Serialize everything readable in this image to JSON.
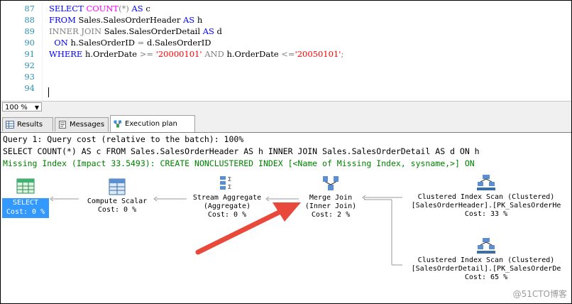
{
  "editor": {
    "line_numbers": [
      "87",
      "88",
      "89",
      "90",
      "91",
      "92",
      "93",
      "94"
    ],
    "lines": [
      [
        "SELECT ",
        "COUNT",
        "(*)",
        " AS ",
        "c"
      ],
      [
        "FROM ",
        "Sales.SalesOrderHeader ",
        "AS ",
        "h"
      ],
      [
        "INNER JOIN ",
        "Sales.SalesOrderDetail ",
        "AS ",
        "d"
      ],
      [
        "  ON ",
        "h.SalesOrderID ",
        "= ",
        "d.SalesOrderID"
      ],
      [
        "WHERE ",
        "h.OrderDate ",
        ">= ",
        "'20000101'",
        " AND ",
        "h.OrderDate ",
        "<=",
        "'20050101'",
        ";"
      ]
    ]
  },
  "zoom": {
    "value": "100 %"
  },
  "tabs": {
    "results": "Results",
    "messages": "Messages",
    "execution_plan": "Execution plan"
  },
  "plan": {
    "query_cost": "Query 1: Query cost (relative to the batch): 100%",
    "sql_text": "SELECT COUNT(*) AS c FROM Sales.SalesOrderHeader AS h INNER JOIN Sales.SalesOrderDetail AS d ON h",
    "missing_index": "Missing Index (Impact 33.5493): CREATE NONCLUSTERED INDEX [<Name of Missing Index, sysname,>] ON",
    "nodes": {
      "select": {
        "name": "SELECT",
        "cost": "Cost: 0 %"
      },
      "compute": {
        "name": "Compute Scalar",
        "cost": "Cost: 0 %"
      },
      "stream": {
        "name": "Stream Aggregate",
        "sub": "(Aggregate)",
        "cost": "Cost: 0 %"
      },
      "merge": {
        "name": "Merge Join",
        "sub": "(Inner Join)",
        "cost": "Cost: 2 %"
      },
      "scan1": {
        "name": "Clustered Index Scan (Clustered)",
        "sub": "[SalesOrderHeader].[PK_SalesOrderHe",
        "cost": "Cost: 33 %"
      },
      "scan2": {
        "name": "Clustered Index Scan (Clustered)",
        "sub": "[SalesOrderDetail].[PK_SalesOrderDe",
        "cost": "Cost: 65 %"
      }
    }
  },
  "watermark": "@51CTO博客",
  "colors": {
    "keyword": "#0000ff",
    "function": "#ff00ff",
    "string": "#ff0000",
    "missing_index": "#008000",
    "arrow": "#e8493a",
    "selected": "#3399ff"
  }
}
